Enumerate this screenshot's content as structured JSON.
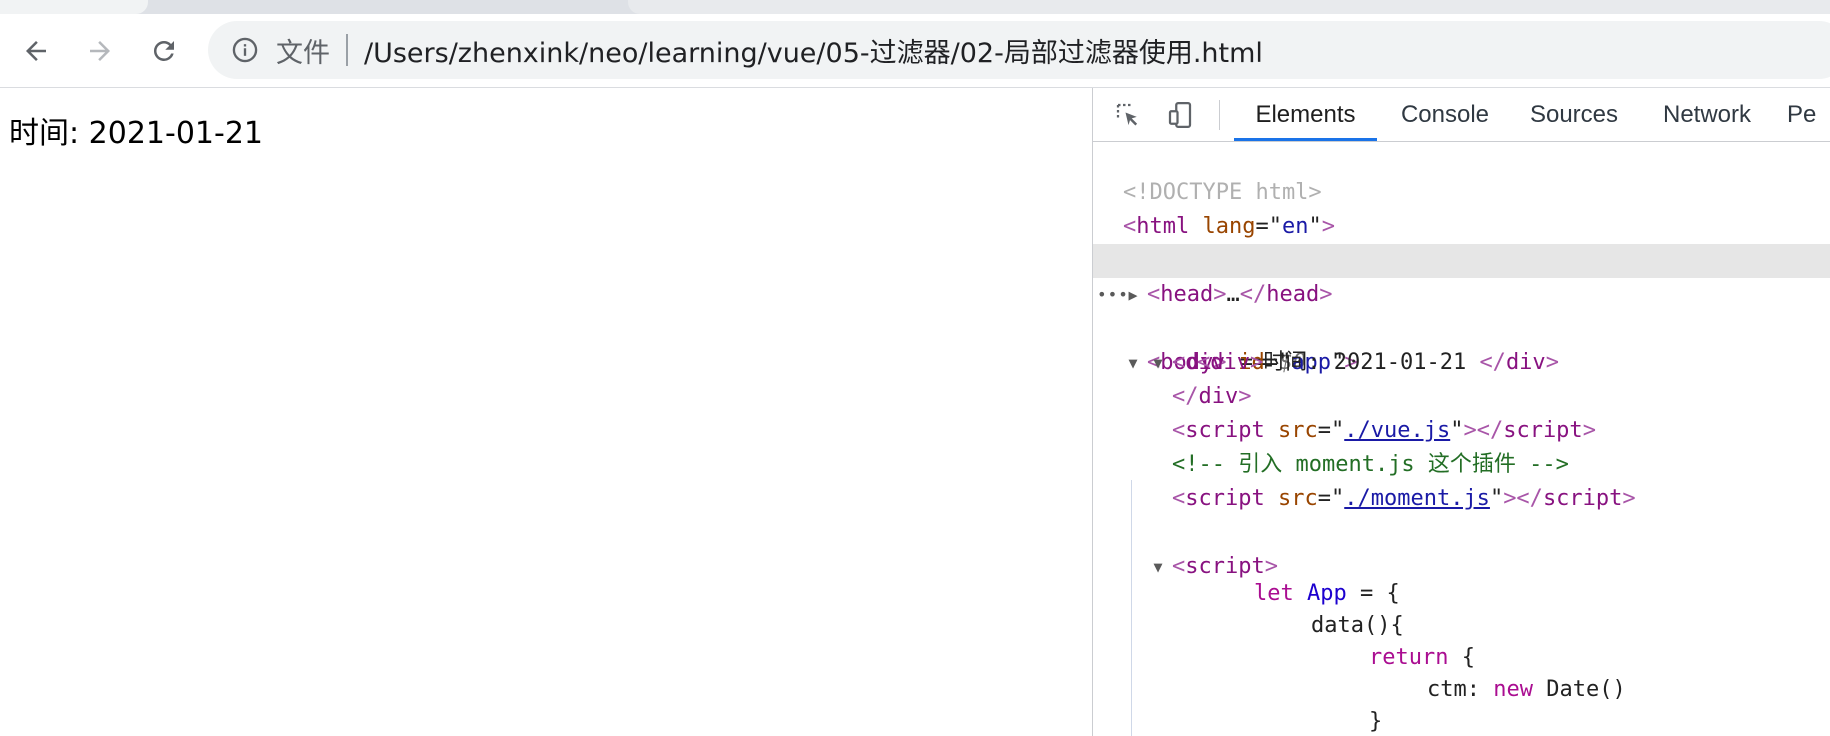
{
  "browser": {
    "address_bar": {
      "scheme_label": "文件",
      "url": "/Users/zhenxink/neo/learning/vue/05-过滤器/02-局部过滤器使用.html"
    },
    "icons": {
      "back": "arrow-left-icon",
      "forward": "arrow-right-icon",
      "reload": "reload-icon",
      "info": "info-circle-icon"
    }
  },
  "page": {
    "content_text": "时间: 2021-01-21"
  },
  "devtools": {
    "tabs": [
      {
        "label": "Elements",
        "active": true
      },
      {
        "label": "Console",
        "active": false
      },
      {
        "label": "Sources",
        "active": false
      },
      {
        "label": "Network",
        "active": false
      },
      {
        "label": "Pe",
        "active": false
      }
    ],
    "dom": {
      "doctype": "<!DOCTYPE html>",
      "html_tag": "html",
      "html_attr_name": "lang",
      "html_attr_value": "en",
      "head_tag": "head",
      "head_ellipsis": "…",
      "body_tag": "body",
      "body_selected_marker": " == ",
      "body_selected_var": "$0",
      "div_app_tag": "div",
      "div_app_attr_name": "id",
      "div_app_attr_value": "app",
      "inner_div_tag": "div",
      "inner_div_text": "时间: 2021-01-21 ",
      "script1_tag": "script",
      "script1_attr_name": "src",
      "script1_src": "./vue.js",
      "comment": "<!-- 引入 moment.js 这个插件 -->",
      "script2_tag": "script",
      "script2_attr_name": "src",
      "script2_src": "./moment.js",
      "script3_tag": "script",
      "js_let": "let",
      "js_app": "App",
      "js_eq_brace": " = {",
      "js_data_fn": "data(){",
      "js_return": "return",
      "js_return_brace": " {",
      "js_ctm": "ctm: ",
      "js_new": "new",
      "js_date": " Date()",
      "js_close_inner": "}",
      "js_close_data": "},"
    }
  },
  "colors": {
    "tag": "#881280",
    "attribute": "#994500",
    "value": "#1a1aa6",
    "comment": "#236e25",
    "keyword": "#aa0d91",
    "active_tab_underline": "#1a73e8",
    "selected_row": "#e6e6e6"
  }
}
